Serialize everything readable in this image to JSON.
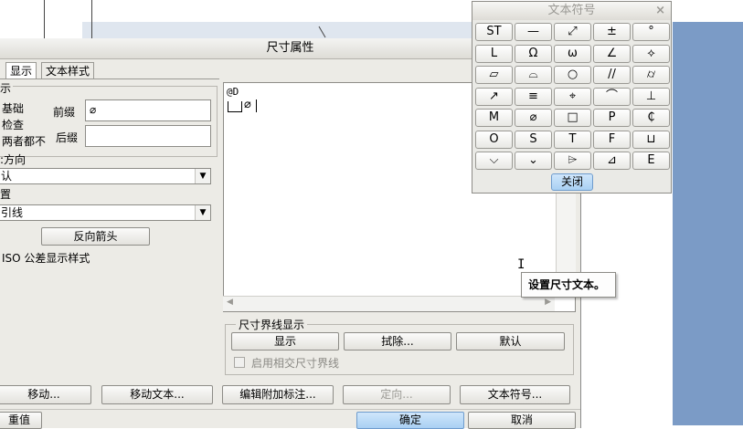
{
  "dialog": {
    "title": "尺寸属性",
    "tabs": [
      "显示",
      "文本样式"
    ],
    "left": {
      "group_heading": "示",
      "radio_basic": "基础",
      "radio_check": "检查",
      "radio_neither": "两者都不",
      "prefix_label": "前缀",
      "prefix_value": "⌀",
      "suffix_label": "后缀",
      "suffix_value": "",
      "direction_heading": ":方向",
      "direction_value": "认",
      "position_heading": "置",
      "leader_value": "引线",
      "reverse_arrow_button": "反向箭头",
      "iso_checkbox": "ISO 公差显示样式"
    },
    "text_editor": {
      "line1": "@D",
      "line2": "⌀"
    },
    "extension_group": {
      "heading": "尺寸界线显示",
      "show_button": "显示",
      "erase_button": "拭除...",
      "default_button": "默认",
      "intersect_checkbox": "启用相交尺寸界线"
    },
    "bottom_buttons": [
      "移动...",
      "移动文本...",
      "编辑附加标注...",
      "定向...",
      "文本符号..."
    ],
    "footer": {
      "left_button": "重值",
      "ok_button": "确定",
      "cancel_button": "取消"
    }
  },
  "tooltip": "设置尺寸文本。",
  "palette": {
    "title": "文本符号",
    "close_x": "×",
    "symbols": [
      "ST",
      "—",
      "⤢",
      "±",
      "°",
      "L",
      "Ω",
      "ω",
      "∠",
      "⟡",
      "▱",
      "⌓",
      "○",
      "//",
      "⌭",
      "↗",
      "≡",
      "⌖",
      "⌒",
      "⊥",
      "M",
      "⌀",
      "□",
      "P",
      "₵",
      "O",
      "S",
      "T",
      "F",
      "⊔",
      "⌵",
      "⌄",
      "⌲",
      "⊿",
      "E"
    ],
    "close_button": "关闭"
  }
}
